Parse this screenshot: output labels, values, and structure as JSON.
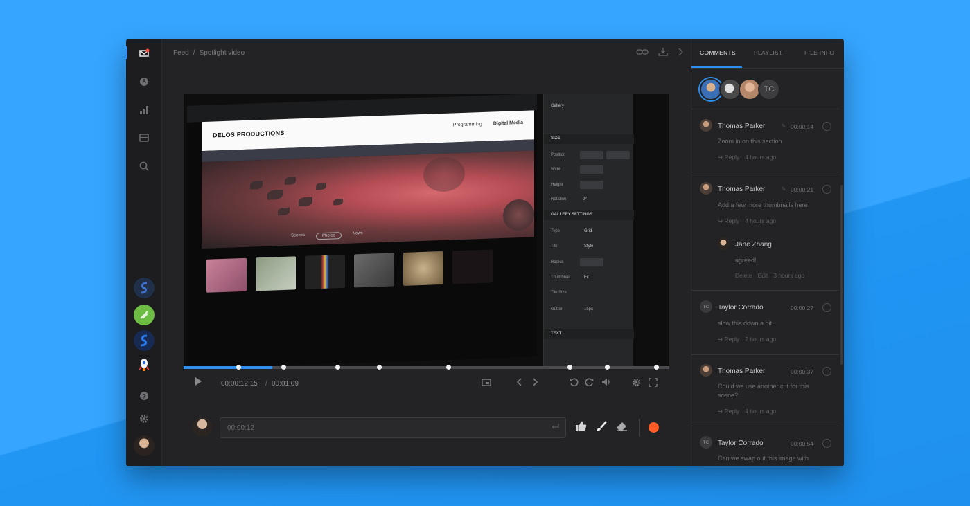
{
  "breadcrumb": {
    "root": "Feed",
    "separator": "/",
    "current": "Spotlight video"
  },
  "tabs": [
    {
      "label": "COMMENTS"
    },
    {
      "label": "PLAYLIST"
    },
    {
      "label": "FILE INFO"
    }
  ],
  "viewers": {
    "initials": "TC"
  },
  "video_content": {
    "site_logo": "DELOS PRODUCTIONS",
    "site_nav": [
      "Programming",
      "Digital Media"
    ],
    "filters": [
      "Scenes",
      "Photos",
      "News"
    ],
    "panel": {
      "gallery": "Gallery",
      "size_header": "SIZE",
      "position": "Position",
      "width": "Width",
      "height": "Height",
      "rotation": "Rotation",
      "rotation_value": "0°",
      "gallery_settings": "GALLERY SETTINGS",
      "type": "Type",
      "type_value": "Grid",
      "tile": "Tile",
      "tile_value": "Style",
      "radius": "Radius",
      "thumbnail": "Thumbnail",
      "thumbnail_value": "Fit",
      "tile_size": "Tile Size",
      "gutter": "Gutter",
      "gutter_value": "15px",
      "text_header": "TEXT"
    }
  },
  "player": {
    "progress": 0.183,
    "markers": [
      0.113,
      0.206,
      0.318,
      0.403,
      0.545,
      0.795,
      0.873,
      0.974
    ],
    "current_time": "00:00:12:15",
    "time_separator": "/",
    "total_time": "00:01:09"
  },
  "comment_input": {
    "value": "00:00:12"
  },
  "comments": [
    {
      "author": "Thomas Parker",
      "time": "00:00:14",
      "text": "Zoom in on this section",
      "reply": "Reply",
      "ago": "4 hours ago"
    },
    {
      "author": "Thomas Parker",
      "time": "00:00:21",
      "text": "Add a few more thumbnails here",
      "reply": "Reply",
      "ago": "4 hours ago"
    },
    {
      "author": "Jane Zhang",
      "text": "agreed!",
      "delete": "Delete",
      "edit": "Edit",
      "ago": "3 hours ago"
    },
    {
      "author": "Taylor Corrado",
      "initials": "TC",
      "time": "00:00:27",
      "text": "slow this down a bit",
      "reply": "Reply",
      "ago": "2 hours ago"
    },
    {
      "author": "Thomas Parker",
      "time": "00:00:37",
      "text": "Could we use another cut for this scene?",
      "reply": "Reply",
      "ago": "4 hours ago"
    },
    {
      "author": "Taylor Corrado",
      "initials": "TC",
      "time": "00:00:54",
      "text": "Can we swap out this image with"
    }
  ],
  "colors": {
    "accent": "#2d8ff0",
    "record": "#ff5b27",
    "background": "#35a5ff"
  },
  "icons": [
    "logo-icon",
    "clock-icon",
    "chart-icon",
    "inbox-icon",
    "search-icon",
    "help-icon",
    "settings-icon",
    "link-icon",
    "download-icon",
    "chevron-right-icon",
    "play-icon",
    "screen-icon",
    "prev-icon",
    "next-icon",
    "rewind-icon",
    "forward-icon",
    "volume-icon",
    "gear-icon",
    "fullscreen-icon",
    "thumbs-up-icon",
    "brush-icon",
    "eraser-icon",
    "record-icon",
    "enter-icon",
    "edit-icon",
    "reply-icon"
  ]
}
